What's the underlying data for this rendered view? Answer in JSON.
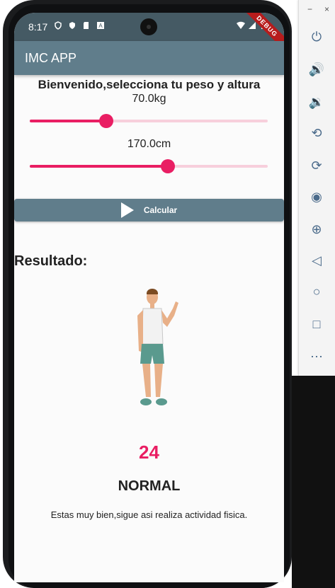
{
  "status": {
    "time": "8:17"
  },
  "debug_banner": "DEBUG",
  "app_bar": {
    "title": "IMC APP"
  },
  "welcome": "Bienvenido,selecciona tu peso y altura",
  "weight": {
    "display": "70.0kg",
    "fraction": 0.32
  },
  "height": {
    "display": "170.0cm",
    "fraction": 0.58
  },
  "calculate_button": {
    "label": "Calcular"
  },
  "result": {
    "label": "Resultado:",
    "value": "24",
    "category": "NORMAL",
    "message": "Estas muy bien,sigue asi realiza actividad fisica."
  },
  "emulator_toolbar": {
    "window_controls": [
      "−",
      "×"
    ],
    "icons": [
      "power-icon",
      "volume-up-icon",
      "volume-down-icon",
      "rotate-left-icon",
      "rotate-right-icon",
      "camera-icon",
      "zoom-icon",
      "back-icon",
      "home-icon",
      "overview-icon",
      "more-icon"
    ]
  },
  "colors": {
    "accent": "#e91e63",
    "appbar": "#607d8b",
    "statusbar": "#455a64"
  }
}
